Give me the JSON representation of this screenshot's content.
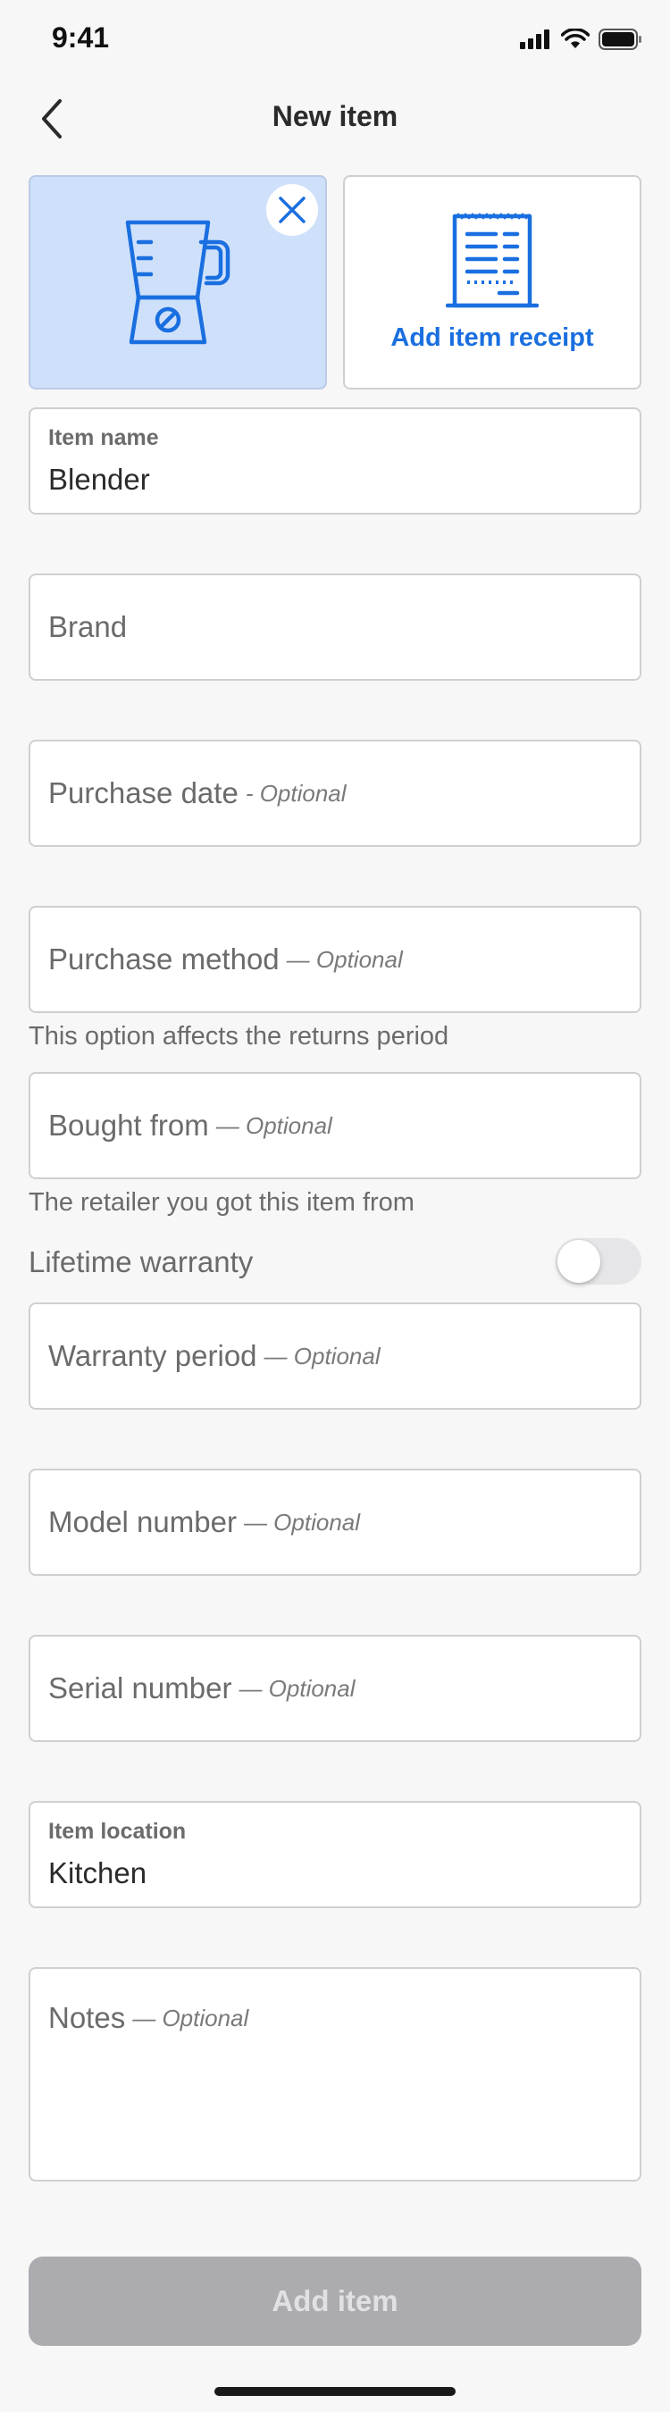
{
  "status_bar": {
    "time": "9:41",
    "icons": [
      "signal-icon",
      "wifi-icon",
      "battery-icon"
    ]
  },
  "nav": {
    "title": "New item",
    "back_icon": "chevron-left-icon"
  },
  "photo": {
    "icon": "blender-icon",
    "remove_icon": "close-icon"
  },
  "receipt": {
    "label": "Add item receipt",
    "icon": "receipt-icon"
  },
  "fields": {
    "item_name": {
      "label": "Item name",
      "value": "Blender"
    },
    "brand": {
      "placeholder": "Brand"
    },
    "purchase_date": {
      "placeholder": "Purchase date",
      "optional": "- Optional"
    },
    "purchase_method": {
      "placeholder": "Purchase method",
      "optional": "— Optional",
      "helper": "This option affects the returns period"
    },
    "bought_from": {
      "placeholder": "Bought from",
      "optional": "— Optional",
      "helper": "The retailer you got this item from"
    },
    "lifetime_warranty": {
      "label": "Lifetime warranty",
      "on": false
    },
    "warranty_period": {
      "placeholder": "Warranty period",
      "optional": "— Optional"
    },
    "model_number": {
      "placeholder": "Model number",
      "optional": "— Optional"
    },
    "serial_number": {
      "placeholder": "Serial number",
      "optional": "— Optional"
    },
    "item_location": {
      "label": "Item location",
      "value": "Kitchen"
    },
    "notes": {
      "placeholder": "Notes",
      "optional": "— Optional"
    }
  },
  "actions": {
    "add_item": "Add item"
  },
  "colors": {
    "accent": "#1a6fe0",
    "photo_bg": "#cfe0fb",
    "button_disabled": "#acacb0",
    "page_bg": "#f7f7f7"
  }
}
